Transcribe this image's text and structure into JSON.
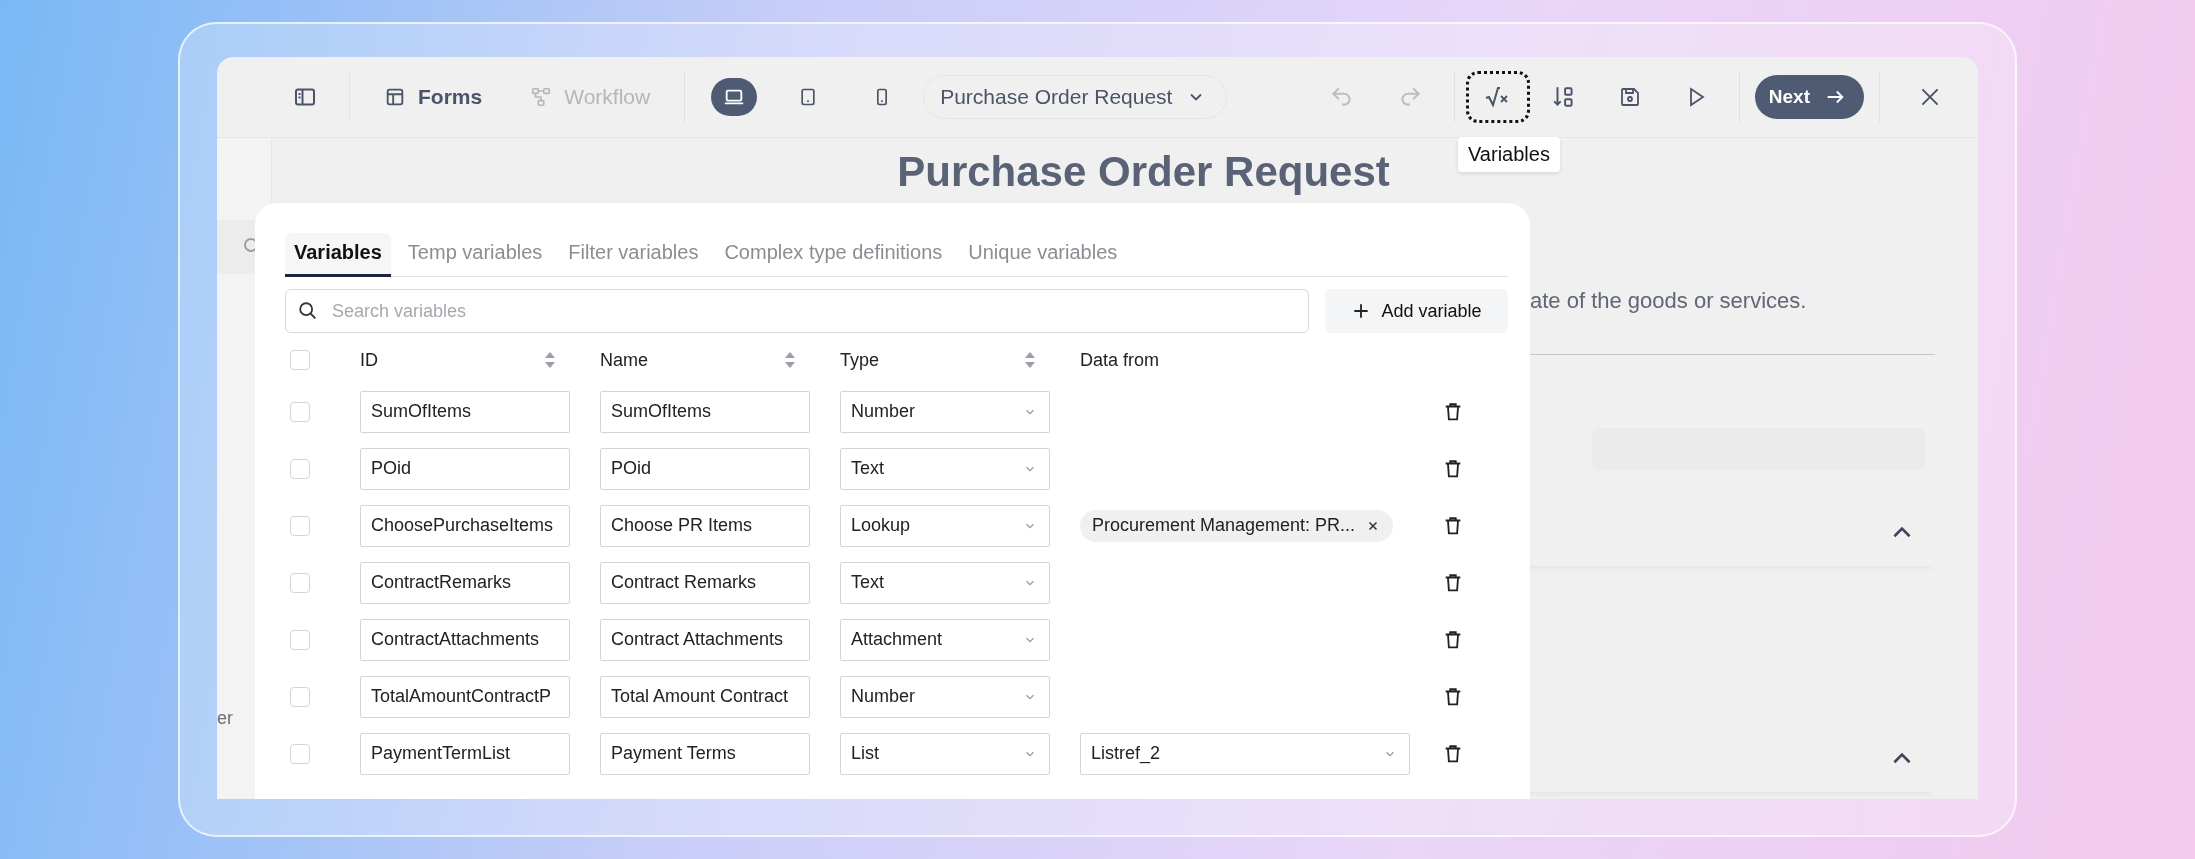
{
  "toolbar": {
    "views": [
      {
        "label": "Forms",
        "selected": true
      },
      {
        "label": "Workflow",
        "selected": false
      }
    ],
    "devices": [
      {
        "kind": "desktop",
        "selected": true
      },
      {
        "kind": "tablet",
        "selected": false
      },
      {
        "kind": "phone",
        "selected": false
      }
    ],
    "form_select": {
      "value": "Purchase Order Request"
    },
    "history": [
      {
        "kind": "undo",
        "disabled": true
      },
      {
        "kind": "redo",
        "disabled": true
      }
    ],
    "tools": [
      {
        "kind": "variables",
        "focused": true
      },
      {
        "kind": "sort",
        "focused": false
      },
      {
        "kind": "save",
        "focused": false
      },
      {
        "kind": "preview",
        "focused": false
      }
    ],
    "next_button": "Next",
    "tooltip": "Variables"
  },
  "sidebar": {
    "label": "er"
  },
  "form": {
    "title": "Purchase Order Request",
    "description": "ate of the goods or services.",
    "sections": [
      {
        "expanded": true
      },
      {
        "expanded": true
      }
    ]
  },
  "variables_dialog": {
    "tabs": [
      {
        "label": "Variables",
        "selected": true
      },
      {
        "label": "Temp variables",
        "selected": false
      },
      {
        "label": "Filter variables",
        "selected": false
      },
      {
        "label": "Complex type definitions",
        "selected": false
      },
      {
        "label": "Unique variables",
        "selected": false
      }
    ],
    "search": {
      "placeholder": "Search variables"
    },
    "add_button": "Add variable",
    "columns": [
      {
        "label": "ID",
        "sortable": true
      },
      {
        "label": "Name",
        "sortable": true
      },
      {
        "label": "Type",
        "sortable": true
      },
      {
        "label": "Data from",
        "sortable": false
      }
    ],
    "select_all": {
      "checked": false
    },
    "rows": [
      {
        "checked": false,
        "id": "SumOfItems",
        "name": "SumOfItems",
        "type": "Number"
      },
      {
        "checked": false,
        "id": "POid",
        "name": "POid",
        "type": "Text"
      },
      {
        "checked": false,
        "id": "ChoosePurchaseItems",
        "name": "Choose PR Items",
        "type": "Lookup",
        "data_from": {
          "kind": "chip",
          "text": "Procurement Management: PR..."
        }
      },
      {
        "checked": false,
        "id": "ContractRemarks",
        "name": "Contract Remarks",
        "type": "Text"
      },
      {
        "checked": false,
        "id": "ContractAttachments",
        "name": "Contract Attachments",
        "type": "Attachment"
      },
      {
        "checked": false,
        "id": "TotalAmountContractP",
        "name": "Total Amount Contract",
        "type": "Number"
      },
      {
        "checked": false,
        "id": "PaymentTermList",
        "name": "Payment Terms",
        "type": "List",
        "data_from": {
          "kind": "select",
          "text": "Listref_2"
        }
      }
    ]
  }
}
